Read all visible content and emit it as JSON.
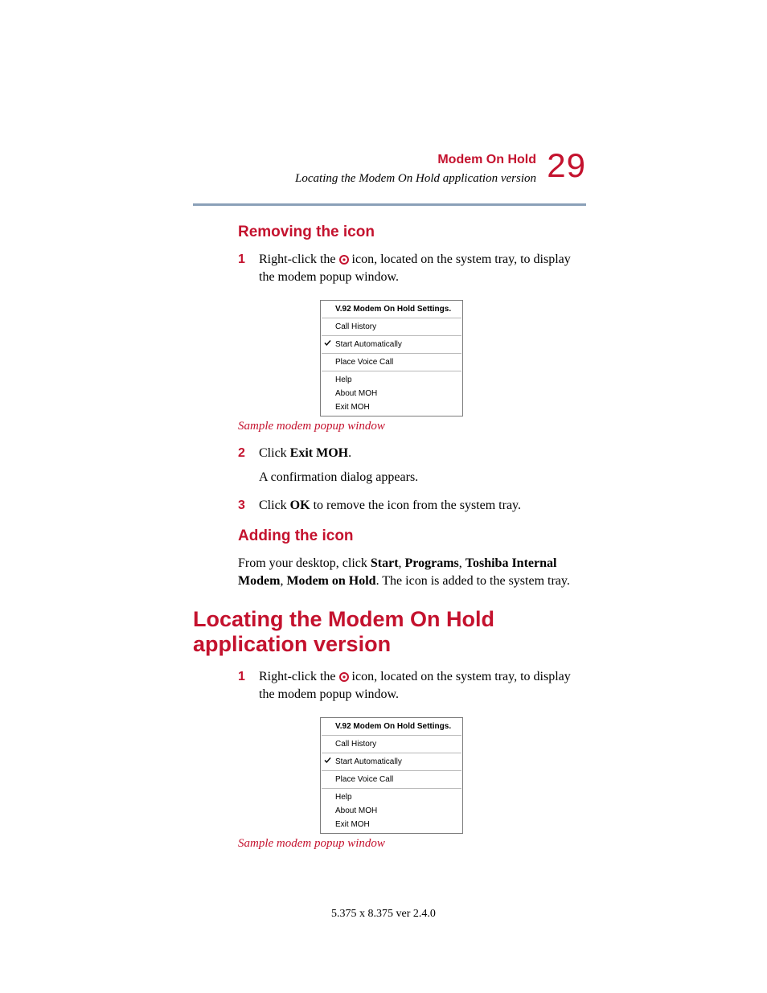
{
  "header": {
    "chapter_title": "Modem On Hold",
    "section_title": "Locating the Modem On Hold application version",
    "page_number": "29"
  },
  "removing": {
    "heading": "Removing the icon",
    "step1_num": "1",
    "step1_a": "Right-click the ",
    "step1_b": " icon, located on the system tray, to display the modem popup window.",
    "caption": "Sample modem popup window",
    "step2_num": "2",
    "step2_a": "Click ",
    "step2_b": "Exit MOH",
    "step2_c": ".",
    "step2_sub": "A confirmation dialog appears.",
    "step3_num": "3",
    "step3_a": "Click ",
    "step3_b": "OK",
    "step3_c": " to remove the icon from the system tray."
  },
  "adding": {
    "heading": "Adding the icon",
    "p1_a": "From your desktop, click ",
    "p1_b": "Start",
    "p1_c": ", ",
    "p1_d": "Programs",
    "p1_e": ", ",
    "p1_f": "Toshiba Internal Modem",
    "p1_g": ", ",
    "p1_h": "Modem on Hold",
    "p1_i": ". The icon is added to the system tray."
  },
  "locating": {
    "heading": "Locating the Modem On Hold application version",
    "step1_num": "1",
    "step1_a": "Right-click the ",
    "step1_b": " icon, located on the system tray, to display the modem popup window.",
    "caption": "Sample modem popup window"
  },
  "popup_menu": {
    "item_settings": "V.92 Modem On Hold Settings.",
    "item_call_history": "Call History",
    "item_start_auto": "Start Automatically",
    "item_place_voice": "Place Voice Call",
    "item_help": "Help",
    "item_about": "About MOH",
    "item_exit": "Exit MOH"
  },
  "footer": {
    "text": "5.375 x 8.375 ver 2.4.0"
  }
}
